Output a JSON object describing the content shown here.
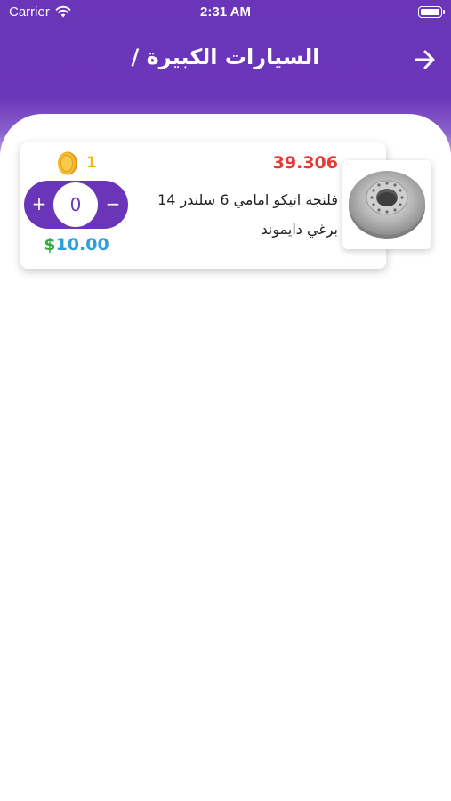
{
  "status_bar": {
    "carrier": "Carrier",
    "time": "2:31 AM"
  },
  "nav": {
    "title": "السيارات الكبيرة /"
  },
  "product": {
    "price": "39.306",
    "name": "فلنجة اتيكو امامي 6 سلندر 14 برغي دايموند",
    "coins": "1",
    "quantity": "0",
    "plus": "+",
    "minus": "−",
    "usd_symbol": "$",
    "usd_amount": "10.00",
    "image_icon": "brake-disc-image"
  },
  "colors": {
    "primary": "#6a35b8",
    "price_red": "#e53935",
    "coin_gold": "#f2b51d",
    "usd_green": "#3aa845",
    "usd_blue": "#2e9fd8"
  }
}
